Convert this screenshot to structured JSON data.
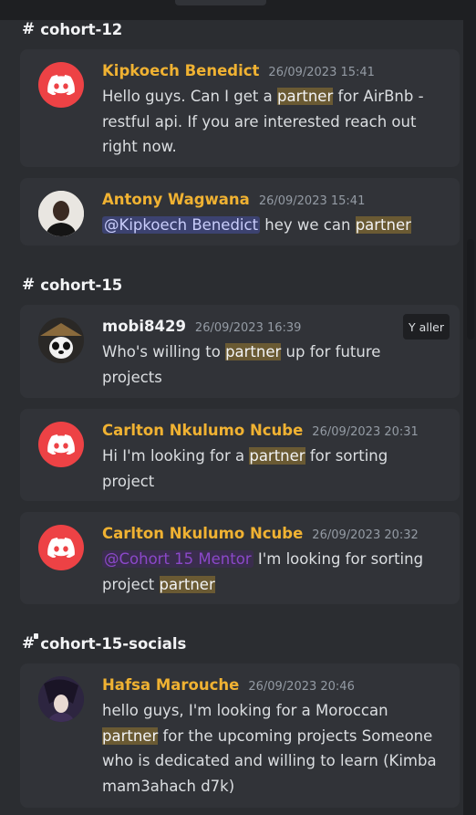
{
  "colors": {
    "background": "#1e1f22",
    "panel": "#2b2d31",
    "card": "#313338",
    "author": "#f0b232",
    "highlight": "#6a5a33",
    "discord_red": "#ed4245"
  },
  "channels": [
    {
      "name": "cohort-12",
      "icon": "hash-icon"
    },
    {
      "name": "cohort-15",
      "icon": "hash-icon"
    },
    {
      "name": "cohort-15-socials",
      "icon": "hash-lock-icon"
    }
  ],
  "messages": [
    {
      "author": "Kipkoech Benedict",
      "timestamp": "26/09/2023 15:41",
      "avatar": "discord-logo-icon",
      "parts": [
        "Hello guys. Can I get a ",
        "partner",
        " for AirBnb - restful api. If you are interested reach out right now."
      ]
    },
    {
      "author": "Antony Wagwana",
      "timestamp": "26/09/2023 15:41",
      "avatar": "user-photo",
      "mention": "@Kipkoech Benedict",
      "parts": [
        " hey we can ",
        "partner"
      ]
    },
    {
      "author": "mobi8429",
      "timestamp": "26/09/2023 16:39",
      "avatar": "user-photo",
      "jump_label": "Y aller",
      "parts": [
        "Who's willing to ",
        "partner",
        " up for future projects"
      ]
    },
    {
      "author": "Carlton Nkulumo Ncube",
      "timestamp": "26/09/2023 20:31",
      "avatar": "discord-logo-icon",
      "parts": [
        "Hi I'm looking for a ",
        "partner",
        " for sorting project"
      ]
    },
    {
      "author": "Carlton Nkulumo Ncube",
      "timestamp": "26/09/2023 20:32",
      "avatar": "discord-logo-icon",
      "mention": "@Cohort 15 Mentor",
      "parts": [
        " I'm looking for sorting project ",
        "partner"
      ]
    },
    {
      "author": "Hafsa Marouche",
      "timestamp": "26/09/2023 20:46",
      "avatar": "user-photo",
      "parts": [
        "hello guys, I'm looking for a Moroccan ",
        "partner",
        " for the upcoming projects Someone who is dedicated and willing to learn (Kimba mam3ahach d7k)"
      ]
    }
  ]
}
